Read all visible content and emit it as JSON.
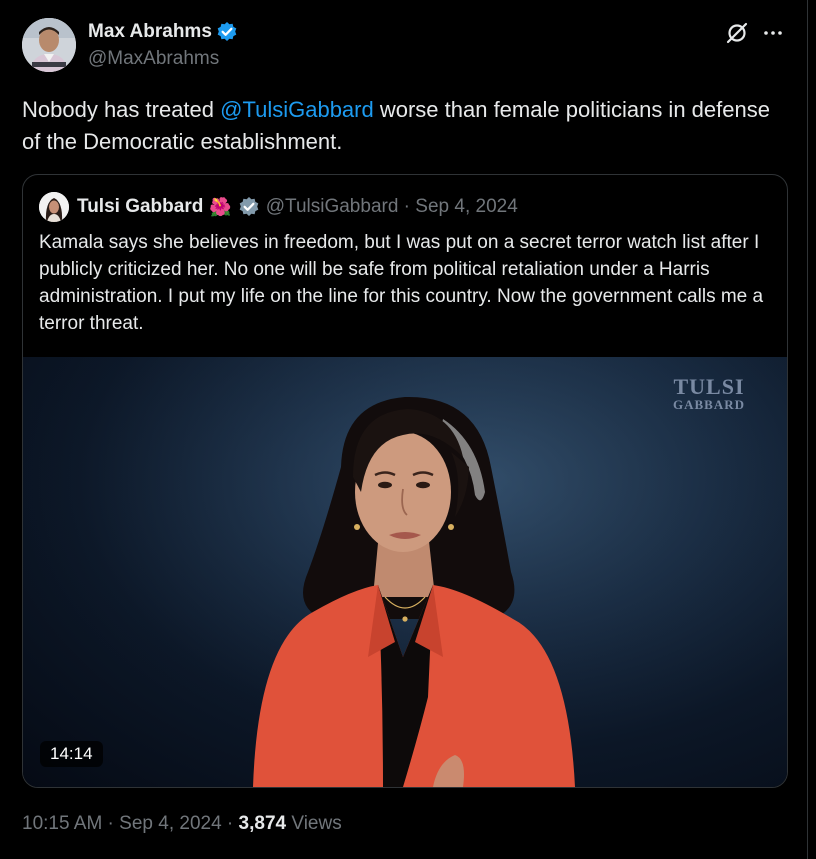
{
  "author": {
    "name": "Max Abrahms",
    "handle": "@MaxAbrahms",
    "verified": true,
    "verified_badge_color": "#1d9bf0"
  },
  "tweet": {
    "text_before": "Nobody has treated ",
    "mention": "@TulsiGabbard",
    "text_after": " worse than female politicians in defense of the Democratic establishment.",
    "mention_color": "#1d9bf0"
  },
  "quote": {
    "name": "Tulsi Gabbard",
    "emoji": "🌺",
    "verified_badge_color": "#829aab",
    "handle": "@TulsiGabbard",
    "separator": " · ",
    "date": "Sep 4, 2024",
    "text": "Kamala says she believes in freedom, but I was put on a secret terror watch list after I publicly criticized her. No one will be safe from political retaliation under a Harris administration. I put my life on the line for this country. Now the government calls me a terror threat.",
    "video": {
      "watermark_line1": "TULSI",
      "watermark_line2": "GABBARD",
      "duration": "14:14"
    }
  },
  "footer": {
    "time": "10:15 AM",
    "sep": " · ",
    "date": "Sep 4, 2024",
    "sep2": " · ",
    "views_count": "3,874",
    "views_label": " Views"
  },
  "icons": {
    "grok": "grok-icon",
    "more": "more-dots-icon",
    "verified": "verified-badge-icon"
  },
  "colors": {
    "background": "#000000",
    "text": "#e7e9ea",
    "secondary": "#71767b",
    "border": "#2f3336",
    "jacket": "#e0523a"
  }
}
